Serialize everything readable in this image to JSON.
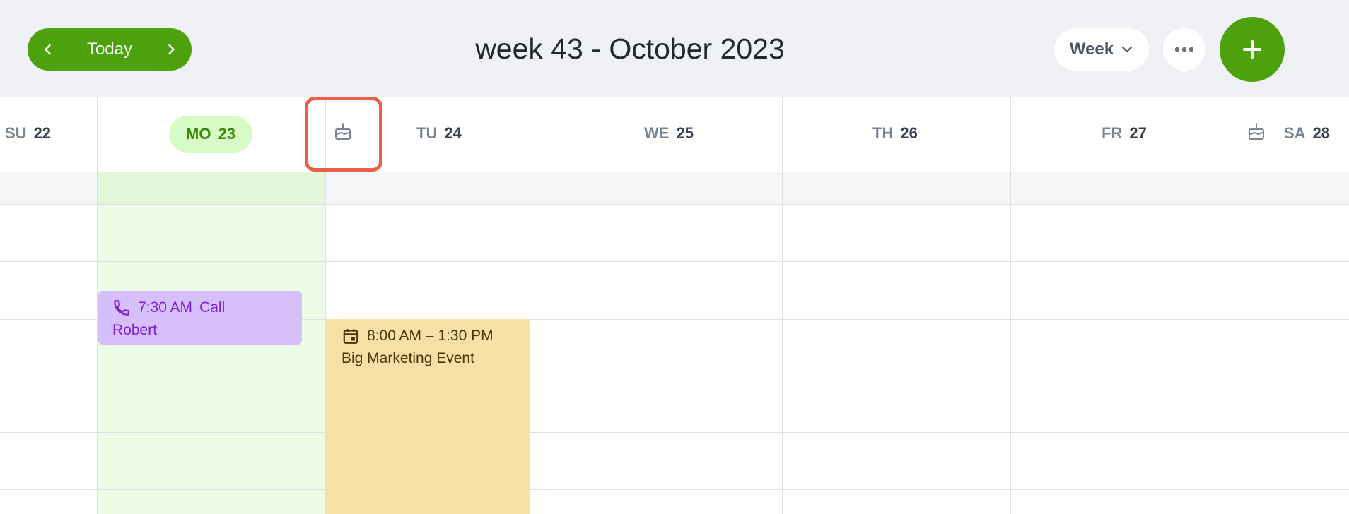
{
  "header": {
    "prev_icon": "chevron-left-icon",
    "today_label": "Today",
    "next_icon": "chevron-right-icon",
    "title": "week 43 - October 2023",
    "view_label": "Week",
    "view_icon": "chevron-down-icon",
    "more_icon": "more-horizontal-icon",
    "add_icon": "plus-icon"
  },
  "colors": {
    "brand_green": "#4ca10c",
    "today_bg": "#edfce6",
    "call_event": "#d6bffa",
    "marketing_event": "#f7e0a6",
    "highlight": "#e8604a"
  },
  "days": [
    {
      "dow": "SU",
      "num": "22",
      "birthday": false,
      "today": false
    },
    {
      "dow": "MO",
      "num": "23",
      "birthday": false,
      "today": true
    },
    {
      "dow": "TU",
      "num": "24",
      "birthday": true,
      "today": false
    },
    {
      "dow": "WE",
      "num": "25",
      "birthday": false,
      "today": false
    },
    {
      "dow": "TH",
      "num": "26",
      "birthday": false,
      "today": false
    },
    {
      "dow": "FR",
      "num": "27",
      "birthday": false,
      "today": false
    },
    {
      "dow": "SA",
      "num": "28",
      "birthday": true,
      "today": false
    }
  ],
  "events": {
    "call": {
      "icon": "phone-icon",
      "time": "7:30 AM",
      "title_line1": "Call",
      "title_line2": "Robert"
    },
    "marketing": {
      "icon": "calendar-event-icon",
      "time": "8:00 AM – 1:30 PM",
      "title": "Big Marketing Event"
    }
  }
}
